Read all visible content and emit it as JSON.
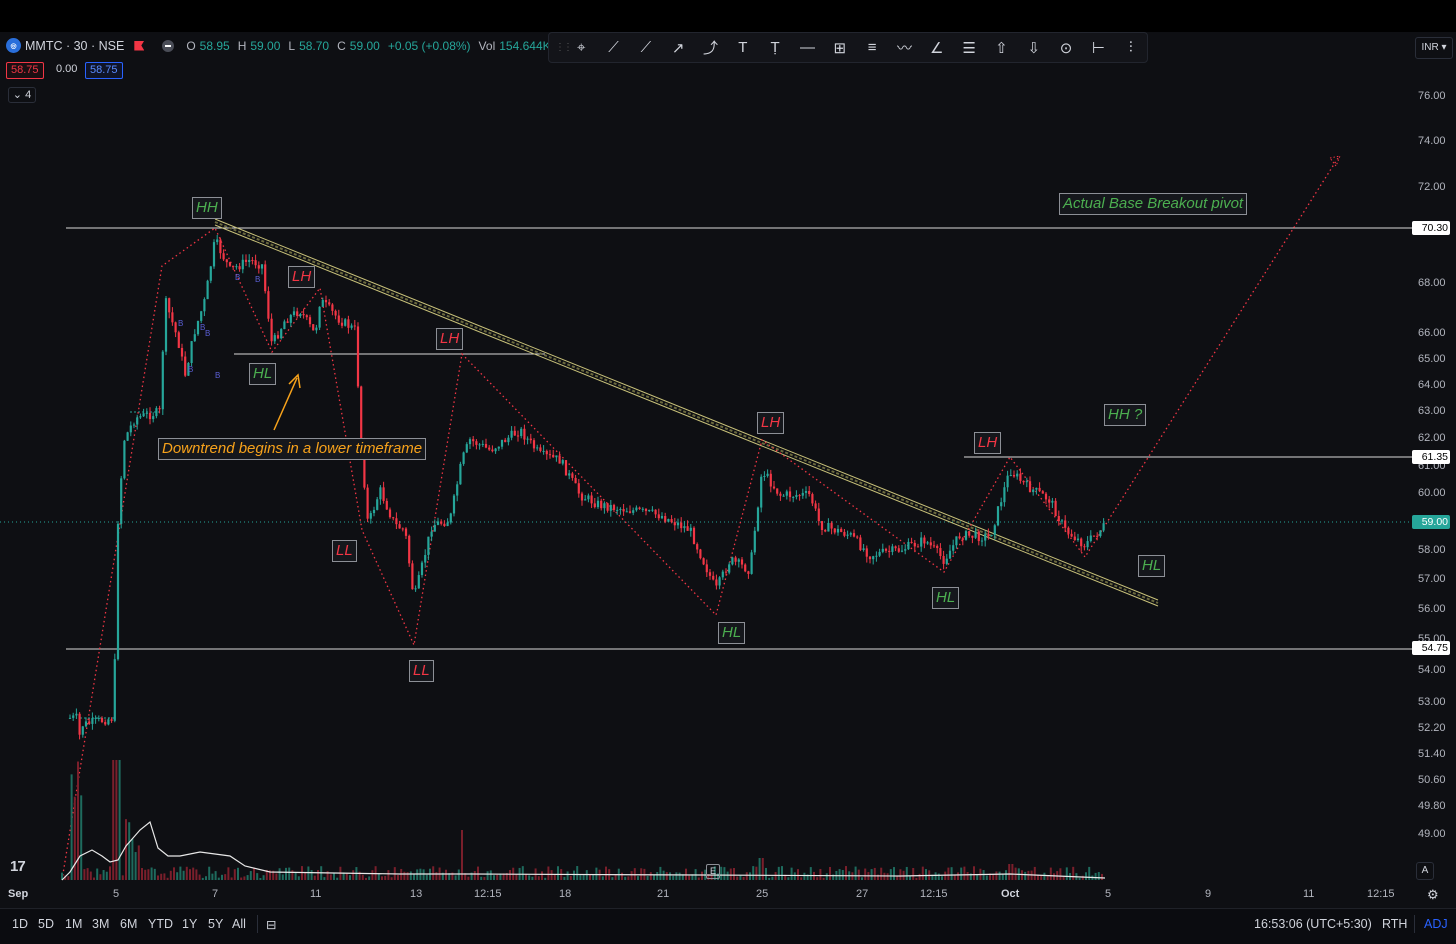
{
  "legend": {
    "symbol": "MMTC · 30 · NSE",
    "logo": "mmtc-logo",
    "o_label": "O",
    "o_val": "58.95",
    "h_label": "H",
    "h_val": "59.00",
    "l_label": "L",
    "l_val": "58.70",
    "c_label": "C",
    "c_val": "59.00",
    "change": "+0.05 (+0.08%)",
    "vol_label": "Vol",
    "vol_val": "154.644K"
  },
  "badges": {
    "bid": "58.75",
    "spread": "0.00",
    "ask": "58.75"
  },
  "indicators_count": "4",
  "currency": "INR",
  "toolbar": {
    "icons": [
      "cursor-icon",
      "trend-line-icon",
      "ray-icon",
      "arrow-icon",
      "path-icon",
      "text-icon",
      "anchored-text-icon",
      "horizontal-line-icon",
      "crosshair-icon",
      "parallel-channel-icon",
      "polyline-icon",
      "fib-icon",
      "hlines-icon",
      "arrow-up-icon",
      "arrow-down-icon",
      "measure-icon",
      "date-range-icon",
      "more-tools-icon"
    ],
    "glyphs": [
      "⌖",
      "⟋",
      "⟋",
      "↗",
      "⤴",
      "T",
      "Ṭ",
      "—",
      "⊞",
      "≡",
      "〰",
      "∠",
      "☰",
      "⇧",
      "⇩",
      "⊙",
      "⊢",
      "⫶"
    ]
  },
  "price_axis": {
    "ticks": [
      "76.00",
      "74.00",
      "72.00",
      "68.00",
      "66.00",
      "65.00",
      "64.00",
      "63.00",
      "62.00",
      "61.00",
      "60.00",
      "58.00",
      "57.00",
      "56.00",
      "55.00",
      "54.00",
      "53.00",
      "52.20",
      "51.40",
      "50.60",
      "49.80",
      "49.00"
    ],
    "highlights": [
      {
        "label": "70.30",
        "color": "#ffffff",
        "text": "#000000"
      },
      {
        "label": "61.35",
        "color": "#ffffff",
        "text": "#000000"
      },
      {
        "label": "59.00",
        "color": "#26a69a",
        "text": "#ffffff"
      },
      {
        "label": "54.75",
        "color": "#ffffff",
        "text": "#000000"
      }
    ]
  },
  "time_axis": [
    "Sep",
    "5",
    "7",
    "11",
    "13",
    "12:15",
    "18",
    "21",
    "25",
    "27",
    "12:15",
    "Oct",
    "5",
    "9",
    "11",
    "12:15"
  ],
  "annotations": {
    "hh1": "HH",
    "lh1": "LH",
    "hl1": "HL",
    "lh2": "LH",
    "ll1": "LL",
    "ll2": "LL",
    "lh3": "LH",
    "hl2": "HL",
    "hl3": "HL",
    "lh4": "LH",
    "hh_q": "HH ?",
    "hl4": "HL",
    "downtrend": "Downtrend begins in a lower timeframe",
    "breakout": "Actual Base Breakout pivot"
  },
  "markers": {
    "event": "E",
    "auto": "A",
    "tv_logo": "17"
  },
  "bottom": {
    "timeframes": [
      "1D",
      "5D",
      "1M",
      "3M",
      "6M",
      "YTD",
      "1Y",
      "5Y",
      "All"
    ],
    "clock": "16:53:06 (UTC+5:30)",
    "rth": "RTH",
    "adj": "ADJ"
  },
  "colors": {
    "up": "#26a69a",
    "down": "#f23645",
    "hl": "#4caf50",
    "note": "#f7a21b",
    "channel": "#c9c27a"
  }
}
